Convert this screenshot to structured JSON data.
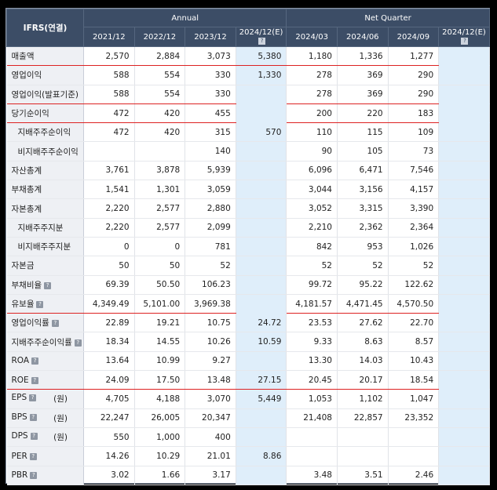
{
  "header": {
    "corner": "IFRS(연결)",
    "group_annual": "Annual",
    "group_quarter": "Net Quarter",
    "periods": [
      "2021/12",
      "2022/12",
      "2023/12",
      "2024/12(E)",
      "2024/03",
      "2024/06",
      "2024/09",
      "2024/12(E)"
    ],
    "estimate_columns": [
      3,
      7
    ]
  },
  "help_icon_glyph": "?",
  "rows": [
    {
      "label": "매출액",
      "unit": "",
      "indent": false,
      "help": false,
      "values": [
        "2,570",
        "2,884",
        "3,073",
        "5,380",
        "1,180",
        "1,336",
        "1,277",
        ""
      ]
    },
    {
      "label": "영업이익",
      "unit": "",
      "indent": false,
      "help": false,
      "values": [
        "588",
        "554",
        "330",
        "1,330",
        "278",
        "369",
        "290",
        ""
      ]
    },
    {
      "label": "영업이익(발표기준)",
      "unit": "",
      "indent": false,
      "help": false,
      "values": [
        "588",
        "554",
        "330",
        "",
        "278",
        "369",
        "290",
        ""
      ]
    },
    {
      "label": "당기순이익",
      "unit": "",
      "indent": false,
      "help": false,
      "values": [
        "472",
        "420",
        "455",
        "",
        "200",
        "220",
        "183",
        ""
      ]
    },
    {
      "label": "지배주주순이익",
      "unit": "",
      "indent": true,
      "help": false,
      "values": [
        "472",
        "420",
        "315",
        "570",
        "110",
        "115",
        "109",
        ""
      ]
    },
    {
      "label": "비지배주주순이익",
      "unit": "",
      "indent": true,
      "help": false,
      "values": [
        "",
        "",
        "140",
        "",
        "90",
        "105",
        "73",
        ""
      ]
    },
    {
      "label": "자산총계",
      "unit": "",
      "indent": false,
      "help": false,
      "values": [
        "3,761",
        "3,878",
        "5,939",
        "",
        "6,096",
        "6,471",
        "7,546",
        ""
      ]
    },
    {
      "label": "부채총계",
      "unit": "",
      "indent": false,
      "help": false,
      "values": [
        "1,541",
        "1,301",
        "3,059",
        "",
        "3,044",
        "3,156",
        "4,157",
        ""
      ]
    },
    {
      "label": "자본총계",
      "unit": "",
      "indent": false,
      "help": false,
      "values": [
        "2,220",
        "2,577",
        "2,880",
        "",
        "3,052",
        "3,315",
        "3,390",
        ""
      ]
    },
    {
      "label": "지배주주지분",
      "unit": "",
      "indent": true,
      "help": false,
      "values": [
        "2,220",
        "2,577",
        "2,099",
        "",
        "2,210",
        "2,362",
        "2,364",
        ""
      ]
    },
    {
      "label": "비지배주주지분",
      "unit": "",
      "indent": true,
      "help": false,
      "values": [
        "0",
        "0",
        "781",
        "",
        "842",
        "953",
        "1,026",
        ""
      ]
    },
    {
      "label": "자본금",
      "unit": "",
      "indent": false,
      "help": false,
      "values": [
        "50",
        "50",
        "52",
        "",
        "52",
        "52",
        "52",
        ""
      ]
    },
    {
      "label": "부채비율",
      "unit": "",
      "indent": false,
      "help": true,
      "values": [
        "69.39",
        "50.50",
        "106.23",
        "",
        "99.72",
        "95.22",
        "122.62",
        ""
      ]
    },
    {
      "label": "유보율",
      "unit": "",
      "indent": false,
      "help": true,
      "values": [
        "4,349.49",
        "5,101.00",
        "3,969.38",
        "",
        "4,181.57",
        "4,471.45",
        "4,570.50",
        ""
      ]
    },
    {
      "label": "영업이익률",
      "unit": "",
      "indent": false,
      "help": true,
      "values": [
        "22.89",
        "19.21",
        "10.75",
        "24.72",
        "23.53",
        "27.62",
        "22.70",
        ""
      ]
    },
    {
      "label": "지배주주순이익률",
      "unit": "",
      "indent": false,
      "help": true,
      "values": [
        "18.34",
        "14.55",
        "10.26",
        "10.59",
        "9.33",
        "8.63",
        "8.57",
        ""
      ]
    },
    {
      "label": "ROA",
      "unit": "",
      "indent": false,
      "help": true,
      "values": [
        "13.64",
        "10.99",
        "9.27",
        "",
        "13.30",
        "14.03",
        "10.43",
        ""
      ]
    },
    {
      "label": "ROE",
      "unit": "",
      "indent": false,
      "help": true,
      "values": [
        "24.09",
        "17.50",
        "13.48",
        "27.15",
        "20.45",
        "20.17",
        "18.54",
        ""
      ]
    },
    {
      "label": "EPS",
      "unit": "(원)",
      "indent": false,
      "help": true,
      "values": [
        "4,705",
        "4,188",
        "3,070",
        "5,449",
        "1,053",
        "1,102",
        "1,047",
        ""
      ]
    },
    {
      "label": "BPS",
      "unit": "(원)",
      "indent": false,
      "help": true,
      "values": [
        "22,247",
        "26,005",
        "20,347",
        "",
        "21,408",
        "22,857",
        "23,352",
        ""
      ]
    },
    {
      "label": "DPS",
      "unit": "(원)",
      "indent": false,
      "help": true,
      "values": [
        "550",
        "1,000",
        "400",
        "",
        "",
        "",
        "",
        ""
      ]
    },
    {
      "label": "PER",
      "unit": "",
      "indent": false,
      "help": true,
      "values": [
        "14.26",
        "10.29",
        "21.01",
        "8.86",
        "",
        "",
        "",
        ""
      ]
    },
    {
      "label": "PBR",
      "unit": "",
      "indent": false,
      "help": true,
      "values": [
        "3.02",
        "1.66",
        "3.17",
        "",
        "3.48",
        "3.51",
        "2.46",
        ""
      ]
    }
  ],
  "red_underline_rows": [
    0,
    2,
    3,
    13,
    17
  ]
}
